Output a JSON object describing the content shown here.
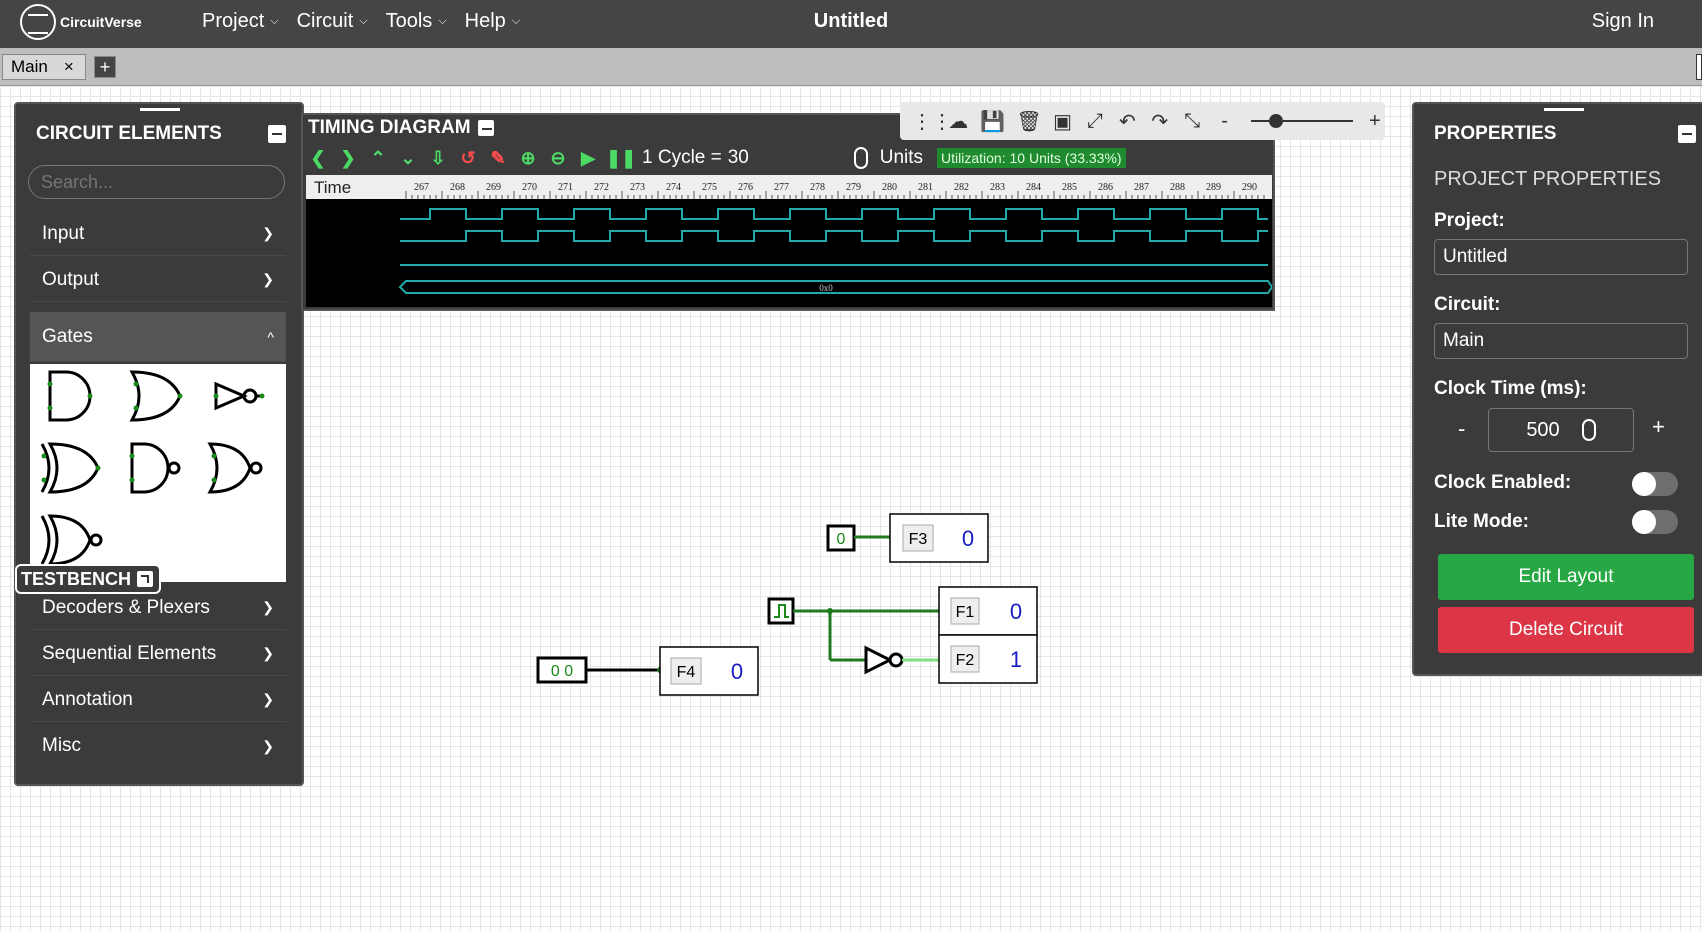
{
  "app": {
    "logo_text": "CircuitVerse",
    "title": "Untitled",
    "signin": "Sign In"
  },
  "menu": [
    {
      "label": "Project"
    },
    {
      "label": "Circuit"
    },
    {
      "label": "Tools"
    },
    {
      "label": "Help"
    }
  ],
  "tabs": [
    {
      "label": "Main",
      "close": "×"
    }
  ],
  "tab_add": "+",
  "elements_panel": {
    "title": "CIRCUIT ELEMENTS",
    "search_placeholder": "Search...",
    "categories": [
      "Input",
      "Output",
      "Gates",
      "Decoders & Plexers",
      "Sequential Elements",
      "Annotation",
      "Misc"
    ],
    "open_category": "Gates",
    "gates": [
      "and-gate",
      "or-gate",
      "not-gate",
      "xor-gate",
      "nand-gate",
      "nor-gate",
      "xnor-gate"
    ]
  },
  "testbench": "TESTBENCH",
  "timing": {
    "title": "TIMING DIAGRAM",
    "cycle_label": "1 Cycle =",
    "cycle_value": "30",
    "units": "Units",
    "utilization": "Utilization: 10 Units (33.33%)",
    "time_label": "Time",
    "ticks": [
      "267",
      "268",
      "269",
      "270",
      "271",
      "272",
      "273",
      "274",
      "275",
      "276",
      "277",
      "278",
      "279",
      "280",
      "281",
      "282",
      "283",
      "284",
      "285",
      "286",
      "287",
      "288",
      "289",
      "290"
    ],
    "bus_value": "0x0"
  },
  "properties": {
    "title": "PROPERTIES",
    "subtitle": "PROJECT PROPERTIES",
    "project_label": "Project:",
    "project_value": "Untitled",
    "circuit_label": "Circuit:",
    "circuit_value": "Main",
    "clock_label": "Clock Time (ms):",
    "clock_value": "500",
    "minus": "-",
    "plus": "+",
    "clock_enabled_label": "Clock Enabled:",
    "clock_enabled": false,
    "lite_mode_label": "Lite Mode:",
    "lite_mode": false,
    "edit_layout": "Edit Layout",
    "delete_circuit": "Delete Circuit"
  },
  "circuit": {
    "probes": [
      {
        "label": "F3",
        "value": "0"
      },
      {
        "label": "F1",
        "value": "0"
      },
      {
        "label": "F2",
        "value": "1"
      },
      {
        "label": "F4",
        "value": "0"
      }
    ],
    "input_f3": "0",
    "input_f4": "0 0"
  },
  "colors": {
    "wire": "#1f7a1f",
    "wire_hi": "#7ee07e",
    "probe_value": "#1a1ac8",
    "accent_green": "#28a745",
    "accent_red": "#dc3545"
  }
}
